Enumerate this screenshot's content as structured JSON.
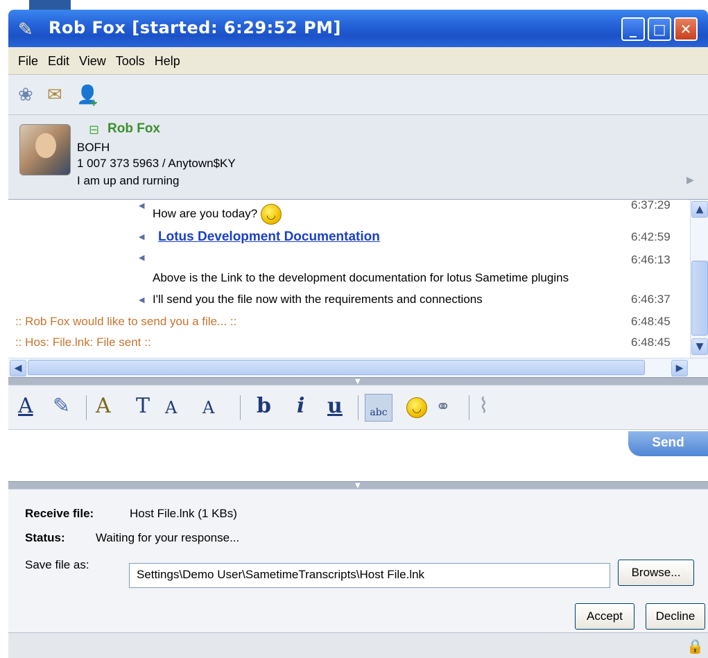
{
  "window": {
    "title": "Rob Fox [started: 6:29:52 PM]",
    "controls": {
      "minimize": "_",
      "maximize": "□",
      "close": "✕"
    }
  },
  "menu": [
    "File",
    "Edit",
    "View",
    "Tools",
    "Help"
  ],
  "toolbar_icons": [
    "group-chat-icon",
    "invite-icon",
    "add-contact-icon"
  ],
  "contact": {
    "name": "Rob Fox",
    "title": "BOFH",
    "phone_location": "1 007 373 5963 / Anytown$KY",
    "status_message": "I am up and rurning"
  },
  "transcript": [
    {
      "text": "How are you today?",
      "time": "6:37:29",
      "emoticon": true
    },
    {
      "text": "Lotus Development Documentation",
      "time": "6:42:59",
      "link": true
    },
    {
      "text": "",
      "time": "6:46:13"
    },
    {
      "text": "Above is the Link to the development documentation for lotus Sametime plugins",
      "time": ""
    },
    {
      "text": "I'll send you the file now with the requirements and connections",
      "time": "6:46:37"
    },
    {
      "text": ":: Rob Fox would like to send you a file... ::",
      "time": "6:48:45",
      "system": true
    },
    {
      "text": ":: Hos: File.lnk: File sent ::",
      "time": "6:48:45",
      "system": true
    }
  ],
  "format_toolbar": {
    "text_color": "A",
    "font": "A",
    "font_style": "T",
    "grow": "A",
    "shrink": "A",
    "bold": "b",
    "italic": "i",
    "underline": "u",
    "spell": "abc"
  },
  "send_label": "Send",
  "file_transfer": {
    "receive_label": "Receive file:",
    "receive_value": "Host File.lnk (1 KBs)",
    "status_label": "Status:",
    "status_value": "Waiting for your response...",
    "save_label": "Save file as:",
    "save_value": "Settings\\Demo User\\SametimeTranscripts\\Host File.lnk",
    "browse_label": "Browse...",
    "accept_label": "Accept",
    "decline_label": "Decline"
  },
  "colors": {
    "titlebar": "#2662d8",
    "link": "#1a3fcc",
    "system_msg": "#c8742e",
    "online": "#3d8f2a"
  }
}
